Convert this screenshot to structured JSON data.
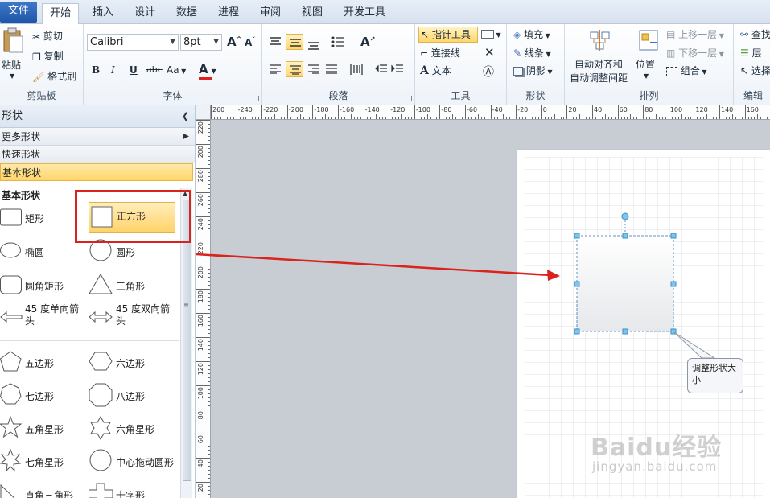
{
  "tabs": [
    {
      "label": "文件"
    },
    {
      "label": "开始"
    },
    {
      "label": "插入"
    },
    {
      "label": "设计"
    },
    {
      "label": "数据"
    },
    {
      "label": "进程"
    },
    {
      "label": "审阅"
    },
    {
      "label": "视图"
    },
    {
      "label": "开发工具"
    }
  ],
  "ribbon": {
    "clipboard": {
      "paste": "粘贴",
      "cut": "剪切",
      "copy": "复制",
      "format_painter": "格式刷",
      "group_label": "剪贴板"
    },
    "font": {
      "font_name": "Calibri",
      "font_size": "8pt",
      "bold": "B",
      "italic": "I",
      "underline": "U",
      "strike": "abc",
      "case": "Aa",
      "color": "A",
      "grow": "A",
      "shrink": "A",
      "group_label": "字体"
    },
    "paragraph": {
      "group_label": "段落",
      "text_dir": "A"
    },
    "tools": {
      "pointer": "指针工具",
      "connector": "连接线",
      "text": "文本",
      "group_label": "工具"
    },
    "shape": {
      "fill": "填充",
      "line": "线条",
      "shadow": "阴影",
      "group_label": "形状"
    },
    "arrange": {
      "auto_align_1": "自动对齐和",
      "auto_align_2": "自动调整间距",
      "position": "位置",
      "bring_forward": "上移一层",
      "send_backward": "下移一层",
      "group": "组合",
      "group_label": "排列"
    },
    "editing": {
      "find": "查找",
      "layer": "层",
      "select": "选择",
      "group_label": "编辑"
    }
  },
  "shapes_panel": {
    "title": "形状",
    "more_shapes": "更多形状",
    "quick_shapes": "快速形状",
    "basic_shapes_stencil": "基本形状",
    "section_title": "基本形状",
    "items": [
      {
        "label": "矩形"
      },
      {
        "label": "正方形"
      },
      {
        "label": "椭圆"
      },
      {
        "label": "圆形"
      },
      {
        "label": "圆角矩形"
      },
      {
        "label": "三角形"
      },
      {
        "label": "45 度单向箭头"
      },
      {
        "label": "45 度双向箭头"
      },
      {
        "label": "五边形"
      },
      {
        "label": "六边形"
      },
      {
        "label": "七边形"
      },
      {
        "label": "八边形"
      },
      {
        "label": "五角星形"
      },
      {
        "label": "六角星形"
      },
      {
        "label": "七角星形"
      },
      {
        "label": "中心拖动圆形"
      },
      {
        "label": "直角三角形"
      },
      {
        "label": "十字形"
      }
    ]
  },
  "ruler": {
    "top_ticks": [
      "260",
      "-240",
      "-220",
      "-200",
      "-180",
      "-160",
      "-140",
      "-120",
      "-100",
      "-80",
      "-60",
      "-40",
      "-20",
      "0",
      "20",
      "40",
      "60",
      "80",
      "100",
      "120",
      "140",
      "160",
      "180"
    ],
    "left_ticks": [
      "220",
      "200",
      "280",
      "260",
      "240",
      "220",
      "200",
      "180",
      "160",
      "140",
      "120",
      "100",
      "80",
      "60",
      "40",
      "20"
    ]
  },
  "canvas": {
    "callout_text": "调整形状大小",
    "watermark": "Baidu经验",
    "watermark_sub": "jingyan.baidu.com"
  },
  "colors": {
    "highlight": "#ffd66a",
    "selection_red": "#d9241e",
    "handle": "#3b8fd0"
  }
}
